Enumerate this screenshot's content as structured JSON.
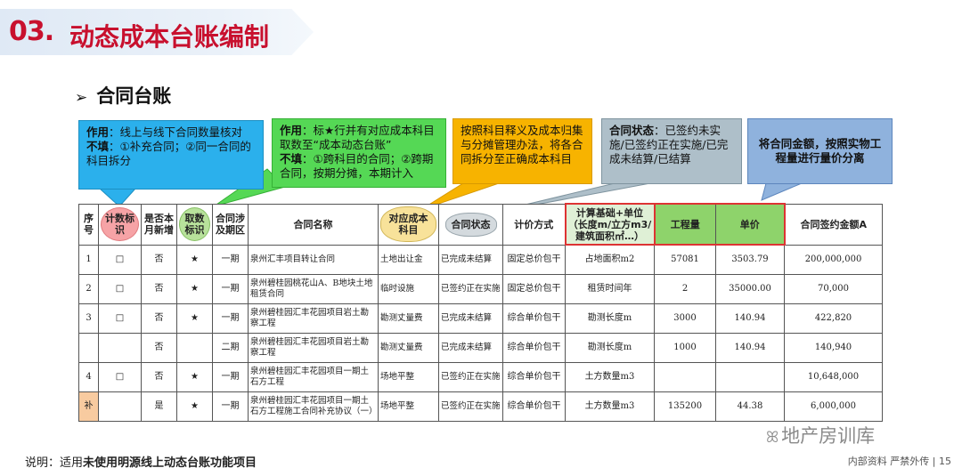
{
  "header": {
    "number": "03.",
    "title": "动态成本台账编制"
  },
  "section": {
    "arrow": "➢",
    "title": "合同台账"
  },
  "callouts": {
    "c1": {
      "label": "作用",
      "text1": "：线上与线下合同数量核对",
      "label2": "不填",
      "text2": "：①补充合同；②同一合同的科目拆分"
    },
    "c2": {
      "label": "作用",
      "text1": "：标★行并有对应成本科目取数至“成本动态台账”",
      "label2": "不填",
      "text2": "：①跨科目的合同；②跨期合同，按期分摊，本期计入"
    },
    "c3": {
      "text": "按照科目释义及成本归集与分摊管理办法，将各合同拆分至正确成本科目"
    },
    "c4": {
      "label": "合同状态",
      "text": "：已签约未实施/已签约正在实施/已完成未结算/已结算"
    },
    "c5": {
      "text": "将合同金额，按照实物工程量进行量价分离"
    }
  },
  "table": {
    "headers": {
      "idx": "序号",
      "count_flag": "计数标识",
      "new_this_month": "是否本月新增",
      "fetch_flag": "取数标识",
      "phase": "合同涉及期区",
      "name": "合同名称",
      "cost_subject": "对应成本科目",
      "status": "合同状态",
      "pricing": "计价方式",
      "basis": "计算基础+单位（长度m/立方m3/建筑面积㎡…）",
      "quantity": "工程量",
      "unit_price": "单价",
      "amount": "合同签约金额A"
    },
    "rows": [
      {
        "idx": "1",
        "count": "□",
        "new": "否",
        "fetch": "★",
        "phase": "一期",
        "name": "泉州汇丰项目转让合同",
        "subject": "土地出让金",
        "status": "已完成未结算",
        "pricing": "固定总价包干",
        "basis": "占地面积m2",
        "qty": "57081",
        "price": "3503.79",
        "amount": "200,000,000"
      },
      {
        "idx": "2",
        "count": "□",
        "new": "否",
        "fetch": "★",
        "phase": "一期",
        "name": "泉州碧桂园桃花山A、B地块土地租赁合同",
        "subject": "临时设施",
        "status": "已签约正在实施",
        "pricing": "固定总价包干",
        "basis": "租赁时间年",
        "qty": "2",
        "price": "35000.00",
        "amount": "70,000"
      },
      {
        "idx": "3",
        "count": "□",
        "new": "否",
        "fetch": "★",
        "phase": "一期",
        "name": "泉州碧桂园汇丰花园项目岩土勘察工程",
        "subject": "勘测丈量费",
        "status": "已完成未结算",
        "pricing": "综合单价包干",
        "basis": "勘测长度m",
        "qty": "3000",
        "price": "140.94",
        "amount": "422,820"
      },
      {
        "idx": "",
        "count": "",
        "new": "否",
        "fetch": "",
        "phase": "二期",
        "name": "泉州碧桂园汇丰花园项目岩土勘察工程",
        "subject": "勘测丈量费",
        "status": "已完成未结算",
        "pricing": "综合单价包干",
        "basis": "勘测长度m",
        "qty": "1000",
        "price": "140.94",
        "amount": "140,940"
      },
      {
        "idx": "4",
        "count": "□",
        "new": "否",
        "fetch": "★",
        "phase": "一期",
        "name": "泉州碧桂园汇丰花园项目一期土石方工程",
        "subject": "场地平整",
        "status": "已签约正在实施",
        "pricing": "综合单价包干",
        "basis": "土方数量m3",
        "qty": "",
        "price": "",
        "amount": "10,648,000"
      },
      {
        "idx": "补",
        "count": "",
        "new": "是",
        "fetch": "★",
        "phase": "一期",
        "name": "泉州碧桂园汇丰花园项目一期土石方工程施工合同补充协议（一）",
        "subject": "场地平整",
        "status": "已签约正在实施",
        "pricing": "综合单价包干",
        "basis": "土方数量m3",
        "qty": "135200",
        "price": "44.38",
        "amount": "6,000,000"
      }
    ]
  },
  "footnote": {
    "prefix": "说明：适用",
    "bold": "未使用明源线上动态台账功能项目"
  },
  "footer": {
    "text": "内部资料 严禁外传 | 15"
  },
  "watermark": {
    "icon": "wechat-icon",
    "text": "地产房训库"
  },
  "colors": {
    "accent": "#c8102e",
    "blue": "#2bb0ec",
    "green": "#55d855",
    "orange": "#f7b300",
    "gray": "#aebfc9",
    "steel": "#8fb2dd"
  }
}
